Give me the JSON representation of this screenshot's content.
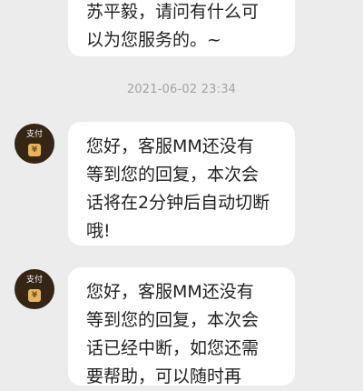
{
  "messages": [
    {
      "lines": [
        "苏平毅，请问有什么可",
        "以为您服务的。~"
      ]
    }
  ],
  "timestamp": "2021-06-02 23:34",
  "bot_avatar": {
    "label": "支付",
    "icon": "coin-icon",
    "icon_glyph": "¥",
    "bg_color": "#352614",
    "icon_color": "#e7b45c"
  },
  "bot_messages": [
    {
      "lines": [
        "您好，客服MM还没有",
        "等到您的回复，本次会",
        "话将在2分钟后自动切断",
        "哦!"
      ]
    },
    {
      "lines": [
        "您好，客服MM还没有",
        "等到您的回复，本次会",
        "话已经中断，如您还需",
        "要帮助，可以随时再"
      ]
    }
  ],
  "colors": {
    "background": "#ececec",
    "bubble": "#ffffff",
    "text": "#222222",
    "timestamp": "#a3a3a3"
  }
}
